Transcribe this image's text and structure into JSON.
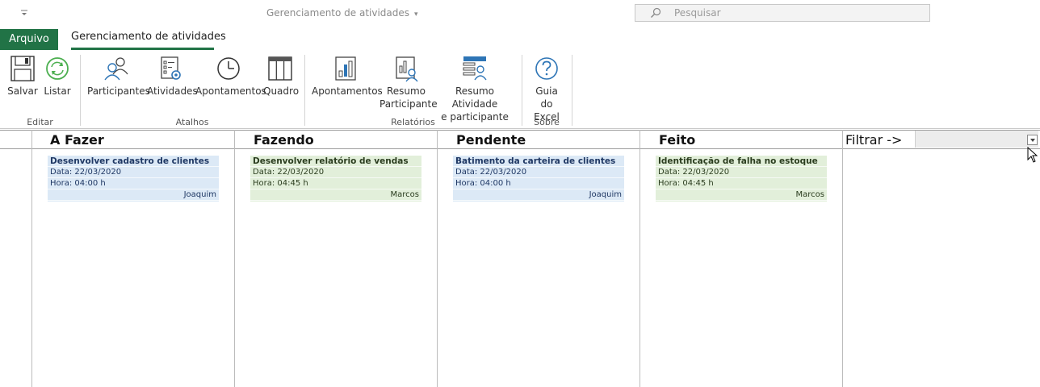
{
  "titlebar": {
    "document_title": "Gerenciamento de atividades",
    "search_placeholder": "Pesquisar"
  },
  "tabs": {
    "file": "Arquivo",
    "main": "Gerenciamento de atividades"
  },
  "ribbon": {
    "groups": {
      "editar": "Editar",
      "atalhos": "Atalhos",
      "relatorios": "Relatórios",
      "sobre": "Sobre"
    },
    "buttons": {
      "salvar": "Salvar",
      "listar": "Listar",
      "participantes": "Participantes",
      "atividades": "Atividades",
      "apontamentos": "Apontamentos",
      "quadro": "Quadro",
      "rel_apontamentos": "Apontamentos",
      "resumo_participante_1": "Resumo",
      "resumo_participante_2": "Participante",
      "resumo_atividade_1": "Resumo Atividade",
      "resumo_atividade_2": "e participante",
      "guia_1": "Guia do",
      "guia_2": "Excel"
    },
    "colors": {
      "accent": "#217346",
      "icon_blue": "#2e75b6",
      "icon_green": "#4caf50"
    }
  },
  "board": {
    "columns": [
      {
        "title": "A Fazer",
        "card": {
          "title": "Desenvolver cadastro de clientes",
          "date": "Data: 22/03/2020",
          "time": "Hora: 04:00 h",
          "person": "Joaquim",
          "color": "#dce9f6"
        }
      },
      {
        "title": "Fazendo",
        "card": {
          "title": "Desenvolver relatório de vendas",
          "date": "Data: 22/03/2020",
          "time": "Hora: 04:45 h",
          "person": "Marcos",
          "color": "#e2efda"
        }
      },
      {
        "title": "Pendente",
        "card": {
          "title": "Batimento da carteira de clientes",
          "date": "Data: 22/03/2020",
          "time": "Hora: 04:00 h",
          "person": "Joaquim",
          "color": "#dce9f6"
        }
      },
      {
        "title": "Feito",
        "card": {
          "title": "Identificação de falha no estoque",
          "date": "Data: 22/03/2020",
          "time": "Hora: 04:45 h",
          "person": "Marcos",
          "color": "#e2efda"
        }
      }
    ],
    "filter_label": "Filtrar ->",
    "filter_value": ""
  }
}
